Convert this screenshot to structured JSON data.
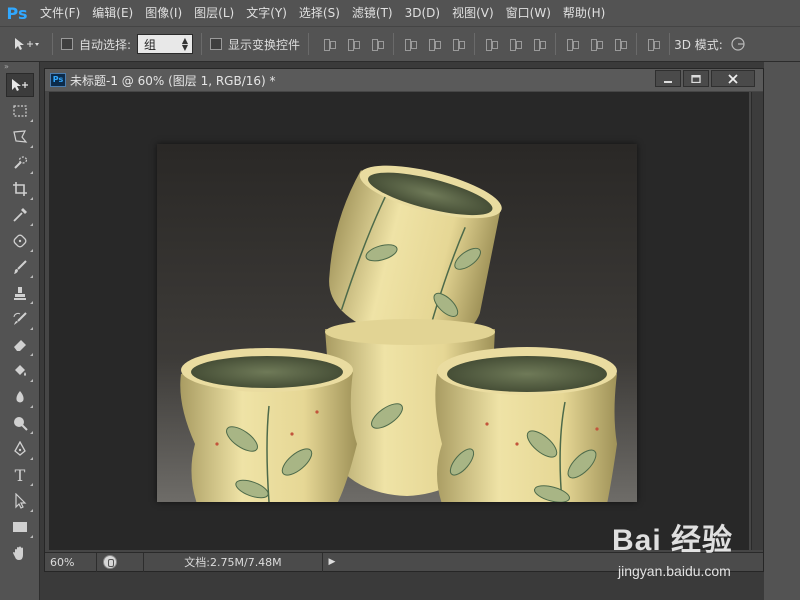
{
  "app": {
    "logo": "Ps",
    "menu": [
      "文件(F)",
      "编辑(E)",
      "图像(I)",
      "图层(L)",
      "文字(Y)",
      "选择(S)",
      "滤镜(T)",
      "3D(D)",
      "视图(V)",
      "窗口(W)",
      "帮助(H)"
    ]
  },
  "options": {
    "auto_select_label": "自动选择:",
    "auto_select_value": "组",
    "show_transform_label": "显示变换控件",
    "mode_3d_label": "3D 模式:"
  },
  "document": {
    "title": "未标题-1 @ 60% (图层 1, RGB/16) *",
    "zoom": "60%",
    "doc_info": "文档:2.75M/7.48M",
    "image_description_icon": "photo-canvas"
  },
  "watermark": {
    "brand": "Bai 经验",
    "url": "jingyan.baidu.com"
  },
  "colors": {
    "ui_panel": "#535353",
    "canvas_bg": "#282828",
    "ps_blue": "#31a8ff"
  }
}
